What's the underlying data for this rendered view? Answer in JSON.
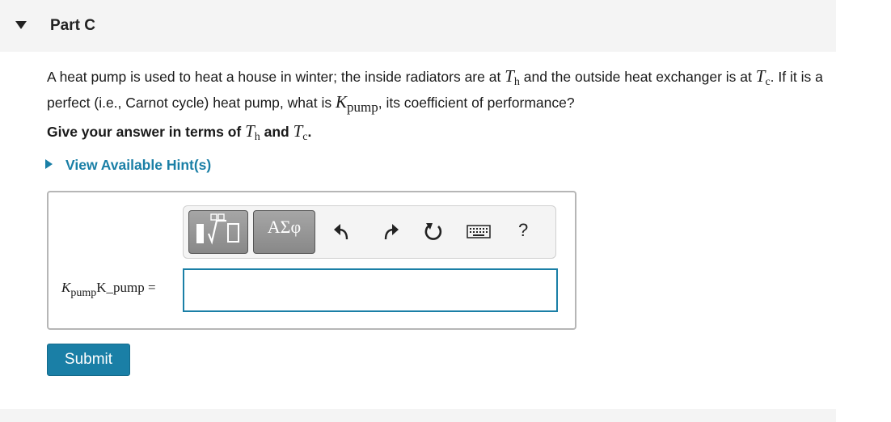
{
  "part": {
    "title": "Part C"
  },
  "question": {
    "text_1": "A heat pump is used to heat a house in winter; the inside radiators are at ",
    "Th_main": "T",
    "Th_sub": "h",
    "text_2": " and the outside heat exchanger is at ",
    "Tc_main": "T",
    "Tc_sub": "c",
    "text_3": ". If it is a perfect (i.e., Carnot cycle) heat pump, what is ",
    "K_main": "K",
    "K_sub": "pump",
    "text_4": ", its coefficient of performance?"
  },
  "instruction": {
    "text_1": "Give your answer in terms of ",
    "Th_main": "T",
    "Th_sub": "h",
    "text_2": " and ",
    "Tc_main": "T",
    "Tc_sub": "c",
    "text_3": "."
  },
  "hint": {
    "label": "View Available Hint(s)"
  },
  "toolbar": {
    "symbols_label": "ΑΣφ",
    "help_label": "?",
    "icons": [
      "templates-icon",
      "undo-icon",
      "redo-icon",
      "reset-icon",
      "keyboard-icon",
      "help-icon"
    ]
  },
  "answer": {
    "label_main": "K",
    "label_sub": "pump",
    "label_raw": "K_pump",
    "equals": " =",
    "value": ""
  },
  "submit": {
    "label": "Submit"
  },
  "colors": {
    "accent": "#1a7fa6",
    "header_bg": "#f4f4f4"
  }
}
